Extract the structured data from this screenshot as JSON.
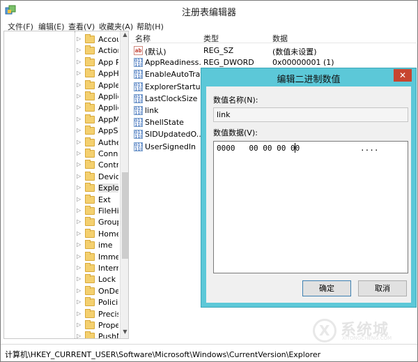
{
  "window": {
    "title": "注册表编辑器"
  },
  "menu": [
    "文件(F)",
    "编辑(E)",
    "查看(V)",
    "收藏夹(A)",
    "帮助(H)"
  ],
  "tree": {
    "items": [
      {
        "label": "Accoun"
      },
      {
        "label": "Action"
      },
      {
        "label": "App Pa"
      },
      {
        "label": "AppHo"
      },
      {
        "label": "Applet"
      },
      {
        "label": "Applica"
      },
      {
        "label": "Applica"
      },
      {
        "label": "AppMo"
      },
      {
        "label": "AppSy"
      },
      {
        "label": "Auther"
      },
      {
        "label": "Conne"
      },
      {
        "label": "Contro"
      },
      {
        "label": "Device"
      },
      {
        "label": "Explor"
      },
      {
        "label": "Ext"
      },
      {
        "label": "FileHis"
      },
      {
        "label": "Group"
      },
      {
        "label": "HomeG"
      },
      {
        "label": "ime"
      },
      {
        "label": "Immer"
      },
      {
        "label": "Interne"
      },
      {
        "label": "Lock S"
      },
      {
        "label": "OnDer"
      },
      {
        "label": "Policie"
      },
      {
        "label": "Precisi"
      },
      {
        "label": "Proper"
      },
      {
        "label": "PushN"
      }
    ],
    "selected_index": 13
  },
  "list": {
    "headers": {
      "name": "名称",
      "type": "类型",
      "data": "数据"
    },
    "rows": [
      {
        "icon": "string-value-icon",
        "name": "(默认)",
        "type": "REG_SZ",
        "data": "(数值未设置)"
      },
      {
        "icon": "binary-value-icon",
        "name": "AppReadiness...",
        "type": "REG_DWORD",
        "data": "0x00000001 (1)"
      },
      {
        "icon": "binary-value-icon",
        "name": "EnableAutoTray",
        "type": "",
        "data": ""
      },
      {
        "icon": "binary-value-icon",
        "name": "ExplorerStartu...",
        "type": "",
        "data": ""
      },
      {
        "icon": "binary-value-icon",
        "name": "LastClockSize",
        "type": "",
        "data": ""
      },
      {
        "icon": "binary-value-icon",
        "name": "link",
        "type": "",
        "data": ""
      },
      {
        "icon": "binary-value-icon",
        "name": "ShellState",
        "type": "",
        "data": ""
      },
      {
        "icon": "binary-value-icon",
        "name": "SIDUpdatedO...",
        "type": "",
        "data": ""
      },
      {
        "icon": "binary-value-icon",
        "name": "UserSignedIn",
        "type": "",
        "data": ""
      }
    ]
  },
  "status": {
    "path": "计算机\\HKEY_CURRENT_USER\\Software\\Microsoft\\Windows\\CurrentVersion\\Explorer"
  },
  "dialog": {
    "title": "编辑二进制数值",
    "close": "✕",
    "name_label": "数值名称(N):",
    "name_value": "link",
    "data_label": "数值数据(V):",
    "hex_line": "0000   00 00 00 00",
    "ascii": "....",
    "ok": "确定",
    "cancel": "取消"
  },
  "watermark": {
    "text": "系统城",
    "sub": "XITONGCHENG.COM"
  },
  "colors": {
    "dialog_frame": "#5cc8d8",
    "close_button": "#c7452f",
    "folder": "#f4d06f"
  }
}
